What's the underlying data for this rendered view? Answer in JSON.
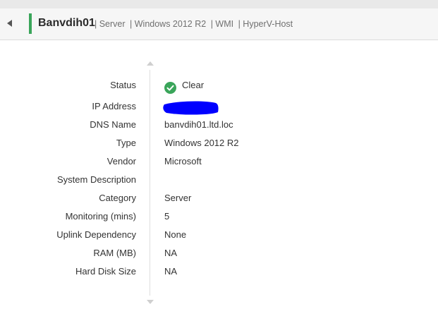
{
  "header": {
    "title": "Banvdih01",
    "tags": [
      "| Server",
      "| Windows 2012 R2",
      "| WMI",
      "| HyperV-Host"
    ],
    "accent_color": "#3aa55a"
  },
  "details": {
    "rows": [
      {
        "label": "Status",
        "value": "Clear"
      },
      {
        "label": "IP Address",
        "value": ""
      },
      {
        "label": "DNS Name",
        "value": "banvdih01.ltd.loc"
      },
      {
        "label": "Type",
        "value": "Windows 2012 R2"
      },
      {
        "label": "Vendor",
        "value": "Microsoft"
      },
      {
        "label": "System Description",
        "value": ""
      },
      {
        "label": "Category",
        "value": "Server"
      },
      {
        "label": "Monitoring  (mins)",
        "value": "5"
      },
      {
        "label": "Uplink Dependency",
        "value": "None"
      },
      {
        "label": "RAM (MB)",
        "value": "NA"
      },
      {
        "label": "Hard Disk Size",
        "value": "NA"
      }
    ],
    "status_color": "#3aa55a",
    "redaction_color": "#0000ff"
  },
  "icons": {
    "back": "caret-left-icon",
    "status": "check-circle-icon",
    "scroll_up": "scroll-up-arrow-icon",
    "scroll_down": "scroll-down-arrow-icon"
  }
}
